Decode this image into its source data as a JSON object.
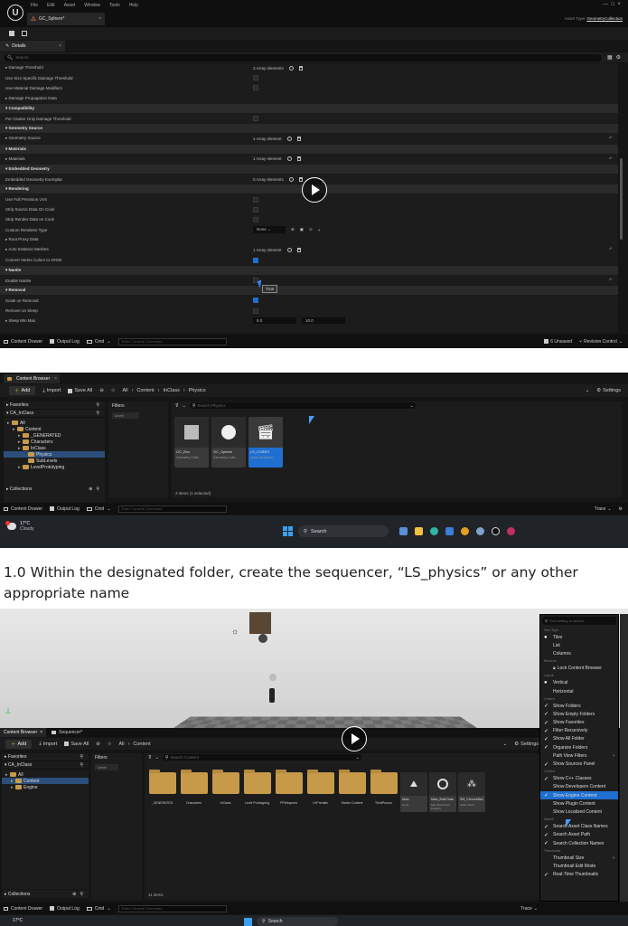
{
  "panel1": {
    "menu": [
      "File",
      "Edit",
      "Asset",
      "Window",
      "Tools",
      "Help"
    ],
    "tab_title": "GC_Sphere*",
    "asset_type_label": "Asset Type:",
    "asset_type_value": "GeometryCollection",
    "details_tab": "Details",
    "search_placeholder": "Search",
    "rows": [
      {
        "label": "Damage Threshold",
        "kind": "expand",
        "value": "3 Array elements",
        "icons": true
      },
      {
        "label": "Use Size Specific Damage Threshold",
        "kind": "prop",
        "check": false
      },
      {
        "label": "Use Material Damage Modifiers",
        "kind": "prop",
        "check": false
      },
      {
        "label": "Damage Propagation Data",
        "kind": "expand"
      },
      {
        "label": "Compatibility",
        "kind": "cat"
      },
      {
        "label": "Per Cluster Only Damage Threshold",
        "kind": "prop",
        "check": false
      },
      {
        "label": "Geometry Source",
        "kind": "cat"
      },
      {
        "label": "Geometry Source",
        "kind": "expand",
        "value": "1 Array element",
        "icons": true
      },
      {
        "label": "Materials",
        "kind": "cat"
      },
      {
        "label": "Materials",
        "kind": "expand",
        "value": "1 Array element",
        "icons": true
      },
      {
        "label": "Embedded Geometry",
        "kind": "cat"
      },
      {
        "label": "Embedded Geometry Exemplar",
        "kind": "prop",
        "value": "0 Array elements",
        "icons": true
      },
      {
        "label": "Rendering",
        "kind": "cat"
      },
      {
        "label": "Use Full Precision UVs",
        "kind": "prop",
        "check": false
      },
      {
        "label": "Strip Source Data On Cook",
        "kind": "prop",
        "check": false
      },
      {
        "label": "Strip Render Data on Cook",
        "kind": "prop",
        "check": false
      },
      {
        "label": "Custom Renderer Type",
        "kind": "prop",
        "value": "None",
        "dropdown": true
      },
      {
        "label": "Root Proxy Data",
        "kind": "expand"
      },
      {
        "label": "Auto Instance Meshes",
        "kind": "expand",
        "value": "1 Array element",
        "icons": true
      },
      {
        "label": "Convert Vertex Colors to sRGB",
        "kind": "prop",
        "check": true
      },
      {
        "label": "Nanite",
        "kind": "cat"
      },
      {
        "label": "Enable Nanite",
        "kind": "prop",
        "check": false
      },
      {
        "label": "Removal",
        "kind": "cat"
      },
      {
        "label": "Scale on Removal",
        "kind": "prop",
        "check": true
      },
      {
        "label": "Remove on Sleep",
        "kind": "prop",
        "check": false
      },
      {
        "label": "Sleep Min Max",
        "kind": "expand",
        "value": "5.0",
        "value2": "10.0"
      }
    ],
    "tooltip": "True",
    "footer": {
      "content_drawer": "Content Drawer",
      "output_log": "Output Log",
      "cmd": "Cmd",
      "console_placeholder": "Enter Console Command",
      "unsaved": "6 Unsaved",
      "revision": "Revision Control"
    }
  },
  "panel2": {
    "tab": "Content Browser",
    "add": "Add",
    "import": "Import",
    "save_all": "Save All",
    "breadcrumb": [
      "All",
      "Content",
      "InClass",
      "Physics"
    ],
    "settings": "Settings",
    "favorites": "Favorites",
    "project": "CA_InClass",
    "filters": "Filters",
    "filter_chip": "Level",
    "search_placeholder": "Search Physics",
    "tree": [
      {
        "label": "All",
        "indent": 0
      },
      {
        "label": "Content",
        "indent": 1
      },
      {
        "label": "_GENERATED",
        "indent": 2
      },
      {
        "label": "Characters",
        "indent": 2
      },
      {
        "label": "InClass",
        "indent": 2
      },
      {
        "label": "Physics",
        "indent": 3,
        "selected": true
      },
      {
        "label": "SubLevels",
        "indent": 3
      },
      {
        "label": "LevelPrototyping",
        "indent": 2
      }
    ],
    "collections": "Collections",
    "tiles": [
      {
        "name": "GC_Box",
        "type": "Geometry Colle..."
      },
      {
        "name": "GC_Sphere",
        "type": "Geometry Colle..."
      },
      {
        "name": "LS_CUBES",
        "type": "Level Sequence",
        "selected": true
      }
    ],
    "status": "3 items (1 selected)",
    "footer": {
      "content_drawer": "Content Drawer",
      "output_log": "Output Log",
      "cmd": "Cmd",
      "console_placeholder": "Enter Console Command",
      "trace": "Trace"
    }
  },
  "taskbar1": {
    "temp": "17°C",
    "weather": "Cloudy",
    "search": "Search"
  },
  "instruction": "1.0 Within the designated folder, create the sequencer, “LS_physics” or any other appropriate name",
  "panel3": {
    "tab1": "Content Browser",
    "tab2": "Sequencer*",
    "add": "Add",
    "import": "Import",
    "save_all": "Save All",
    "breadcrumb": [
      "All",
      "Content"
    ],
    "settings": "Settings",
    "favorites": "Favorites",
    "project": "CA_InClass",
    "filters": "Filters",
    "filter_chip": "Level",
    "search_placeholder": "Search Content",
    "tree": [
      {
        "label": "All",
        "indent": 0
      },
      {
        "label": "Content",
        "indent": 1,
        "selected": true
      },
      {
        "label": "Engine",
        "indent": 1
      }
    ],
    "collections": "Collections",
    "folders": [
      "_GENERATED",
      "Characters",
      "InClass",
      "Level Prototyping",
      "FPWeapons",
      "LKPrevalis",
      "Starter Content",
      "ThirdPerson"
    ],
    "assets": [
      {
        "name": "Main",
        "type": "Level"
      },
      {
        "name": "Main_Built Data",
        "type": "Map Build Data Registry"
      },
      {
        "name": "SM_ChromeBall",
        "type": "Static Mesh"
      }
    ],
    "status": "11 items",
    "footer": {
      "content_drawer": "Content Drawer",
      "output_log": "Output Log",
      "cmd": "Cmd",
      "console_placeholder": "Enter Console Command",
      "trace": "Trace"
    },
    "taskbar_temp": "17°C",
    "taskbar_search": "Search",
    "menu": {
      "search_placeholder": "Find setting to search...",
      "items": [
        {
          "kind": "section",
          "label": "View Type"
        },
        {
          "kind": "radio",
          "label": "Tiles",
          "on": true
        },
        {
          "kind": "radio",
          "label": "List",
          "on": false
        },
        {
          "kind": "radio",
          "label": "Columns",
          "on": false
        },
        {
          "kind": "section",
          "label": "Behavior"
        },
        {
          "kind": "item",
          "label": "Lock Content Browser"
        },
        {
          "kind": "section",
          "label": "Layout"
        },
        {
          "kind": "radio",
          "label": "Vertical",
          "on": true
        },
        {
          "kind": "radio",
          "label": "Horizontal",
          "on": false
        },
        {
          "kind": "section",
          "label": "Content"
        },
        {
          "kind": "check",
          "label": "Show Folders",
          "on": true
        },
        {
          "kind": "check",
          "label": "Show Empty Folders",
          "on": true
        },
        {
          "kind": "check",
          "label": "Show Favorites",
          "on": true
        },
        {
          "kind": "check",
          "label": "Filter Recursively",
          "on": true
        },
        {
          "kind": "check",
          "label": "Show All Folder",
          "on": true
        },
        {
          "kind": "check",
          "label": "Organize Folders",
          "on": true
        },
        {
          "kind": "sub",
          "label": "Path View Filters"
        },
        {
          "kind": "check",
          "label": "Show Sources Panel",
          "on": true
        },
        {
          "kind": "section",
          "label": "Content"
        },
        {
          "kind": "check",
          "label": "Show C++ Classes",
          "on": true
        },
        {
          "kind": "check",
          "label": "Show Developers Content",
          "on": false
        },
        {
          "kind": "check",
          "label": "Show Engine Content",
          "on": true,
          "hover": true
        },
        {
          "kind": "check",
          "label": "Show Plugin Content",
          "on": false
        },
        {
          "kind": "check",
          "label": "Show Localized Content",
          "on": false
        },
        {
          "kind": "section",
          "label": "Search"
        },
        {
          "kind": "check",
          "label": "Search Asset Class Names",
          "on": true
        },
        {
          "kind": "check",
          "label": "Search Asset Path",
          "on": true
        },
        {
          "kind": "check",
          "label": "Search Collection Names",
          "on": true
        },
        {
          "kind": "section",
          "label": "Thumbnails"
        },
        {
          "kind": "sub",
          "label": "Thumbnail Size"
        },
        {
          "kind": "check",
          "label": "Thumbnail Edit Mode",
          "on": false
        },
        {
          "kind": "check",
          "label": "Real-Time Thumbnails",
          "on": true
        }
      ]
    }
  },
  "colors": {
    "editor_bg": "#151515",
    "panel_bg": "#1c1c1c",
    "accent_blue": "#1f6fd1",
    "folder": "#c79a4a"
  }
}
